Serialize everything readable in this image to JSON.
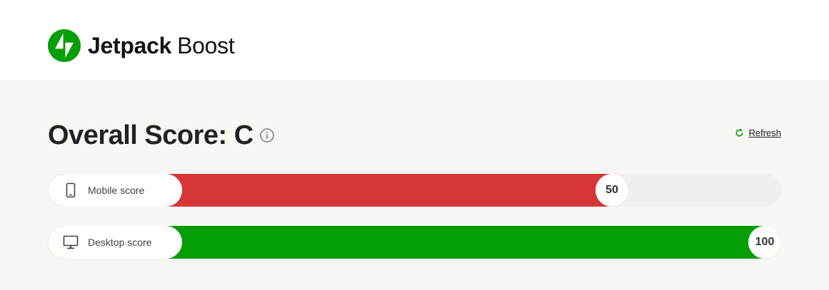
{
  "header": {
    "brand": "Jetpack",
    "product": "Boost",
    "logo_icon": "jetpack-bolt-icon",
    "brand_color": "#069e08"
  },
  "score": {
    "title": "Overall Score: C",
    "info_icon": "info-icon",
    "refresh_label": "Refresh",
    "refresh_icon": "refresh-icon"
  },
  "bars": [
    {
      "label": "Mobile score",
      "icon": "mobile-icon",
      "value": 50,
      "max": 100,
      "color": "#d63638"
    },
    {
      "label": "Desktop score",
      "icon": "desktop-icon",
      "value": 100,
      "max": 100,
      "color": "#069e08"
    }
  ]
}
